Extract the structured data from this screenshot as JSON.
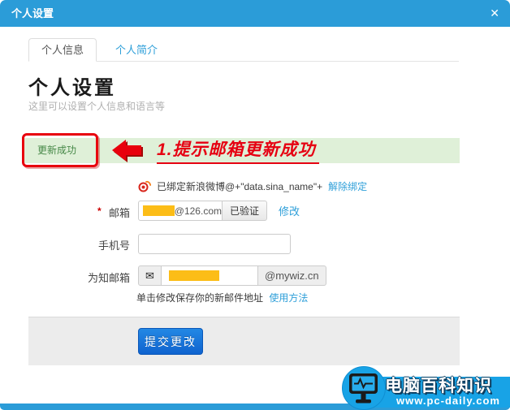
{
  "dialog": {
    "title": "个人设置",
    "close_icon": "✕",
    "tabs": [
      {
        "label": "个人信息"
      },
      {
        "label": "个人简介"
      }
    ],
    "heading": "个人设置",
    "subheading": "这里可以设置个人信息和语言等"
  },
  "alert": {
    "message": "更新成功",
    "annotation": "1.提示邮箱更新成功"
  },
  "weibo": {
    "bound_text": "已绑定新浪微博@+\"data.sina_name\"+",
    "unbind_link": "解除绑定"
  },
  "form": {
    "email": {
      "required_mark": "*",
      "label": "邮箱",
      "domain": "@126.com",
      "verified_button": "已验证",
      "modify_link": "修改"
    },
    "phone": {
      "label": "手机号",
      "value": ""
    },
    "wiz_email": {
      "label": "为知邮箱",
      "envelope_icon": "✉",
      "suffix": "@mywiz.cn"
    },
    "hint": {
      "text": "单击修改保存你的新邮件地址",
      "link": "使用方法"
    },
    "submit_button": "提交更改"
  },
  "watermark": {
    "site_name": "电脑百科知识",
    "site_url": "www.pc-daily.com"
  },
  "colors": {
    "header_blue": "#2b9cd8",
    "link_blue": "#2e9fd9",
    "alert_bg": "#dff0d8",
    "alert_text": "#468847",
    "annotation_red": "#e60012",
    "mask_yellow": "#fcbd17",
    "watermark_blue": "#18a3e6"
  }
}
